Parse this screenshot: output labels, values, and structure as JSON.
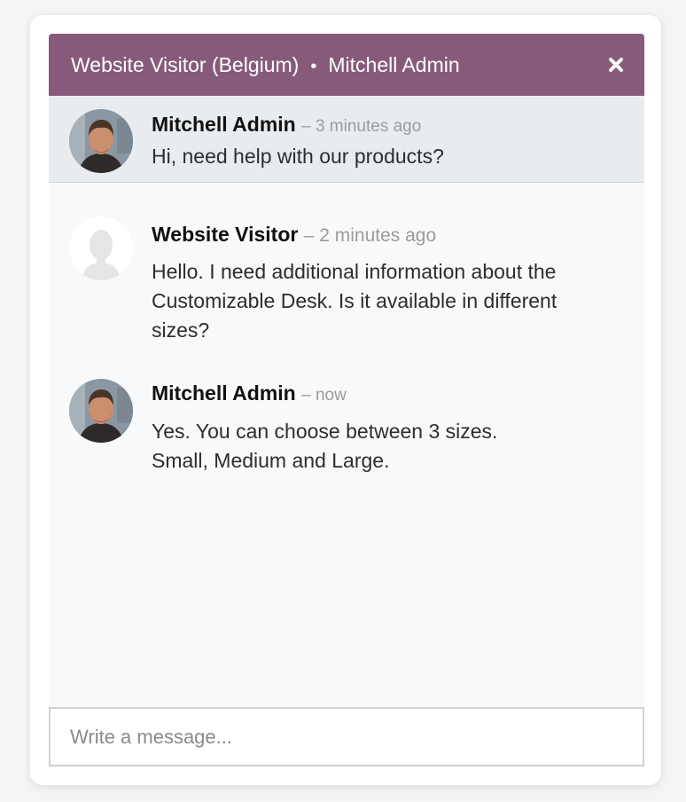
{
  "colors": {
    "header_bg": "#875a7b",
    "pinned_bg": "#e9ecef",
    "thread_bg": "#f8f9fa"
  },
  "header": {
    "visitor": "Website Visitor (Belgium)",
    "separator": "•",
    "operator": "Mitchell Admin",
    "close_icon": "close-icon"
  },
  "messages": [
    {
      "author": "Mitchell Admin",
      "date": "– 3 minutes ago",
      "text": "Hi, need help with our products?",
      "avatar": "operator-avatar"
    },
    {
      "author": "Website Visitor",
      "date": "– 2 minutes ago",
      "text": "Hello. I need additional information about the Customizable Desk. Is it available in different sizes?",
      "avatar": "visitor-avatar"
    },
    {
      "author": "Mitchell Admin",
      "date": "– now",
      "text": "Yes. You can choose between 3 sizes. Small, Medium and Large.",
      "avatar": "operator-avatar"
    }
  ],
  "composer": {
    "placeholder": "Write a message...",
    "value": ""
  }
}
